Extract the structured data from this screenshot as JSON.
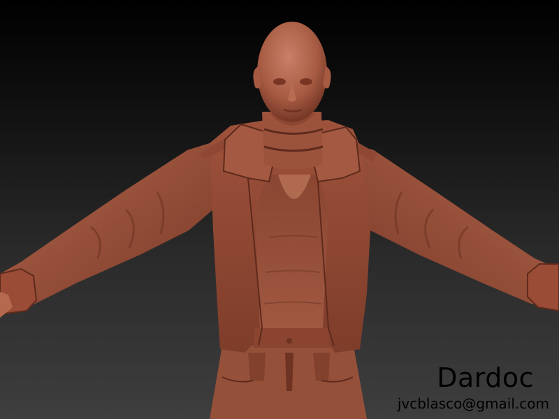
{
  "signature": {
    "name": "Dardoc",
    "email": "jvcblasco@gmail.com"
  },
  "colors": {
    "background_top": "#000000",
    "background_bottom": "#3e3e3e",
    "clay_base": "#a0553e",
    "clay_highlight": "#c27258",
    "clay_shadow": "#5e2a1c"
  }
}
